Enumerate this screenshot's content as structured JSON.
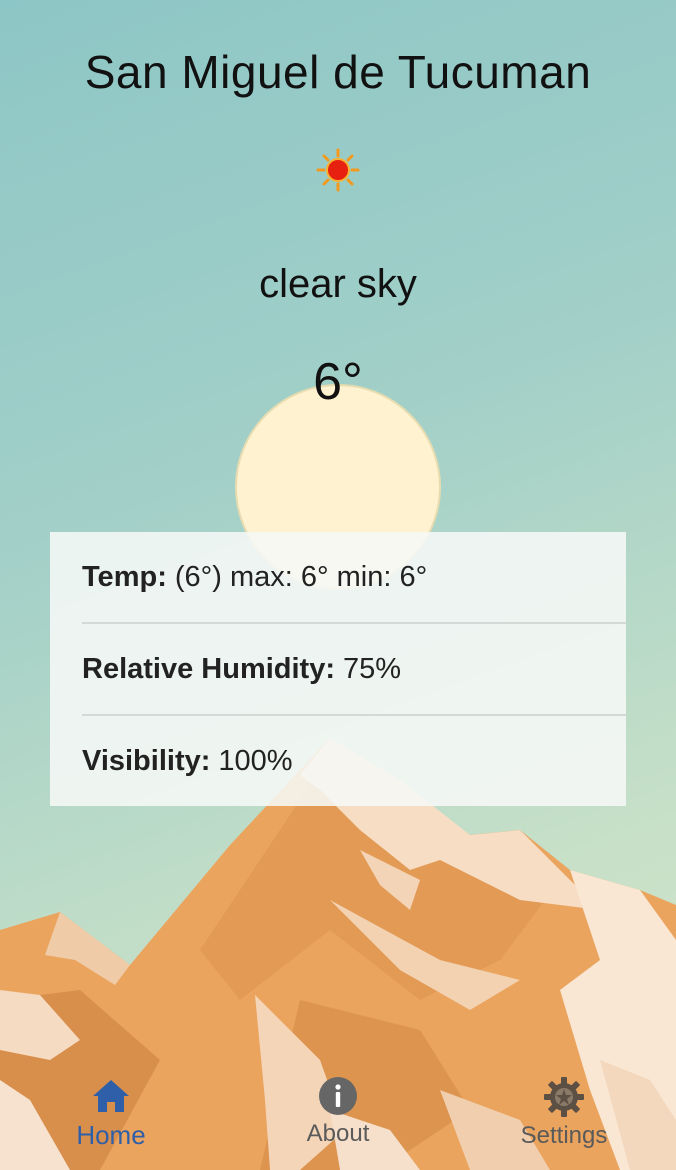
{
  "location": {
    "city": "San Miguel de Tucuman"
  },
  "weather": {
    "icon": "sun-icon",
    "condition": "clear sky",
    "temperature": "6°"
  },
  "details": {
    "temp_label": "Temp:",
    "temp_value": "(6°) max: 6° min: 6°",
    "humidity_label": "Relative Humidity:",
    "humidity_value": "75%",
    "visibility_label": "Visibility:",
    "visibility_value": "100%"
  },
  "nav": {
    "items": [
      {
        "label": "Home",
        "icon": "home-icon",
        "active": true
      },
      {
        "label": "About",
        "icon": "info-icon",
        "active": false
      },
      {
        "label": "Settings",
        "icon": "gear-icon",
        "active": false
      }
    ]
  },
  "colors": {
    "sky_top": "#8dc6c6",
    "sky_bottom": "#d8e6cc",
    "mountain": "#e8a25c",
    "snow": "#f7dfc6",
    "sun_disc": "#fff2d0",
    "active_nav": "#2f5fa8",
    "inactive_nav": "#5a5a5a"
  }
}
